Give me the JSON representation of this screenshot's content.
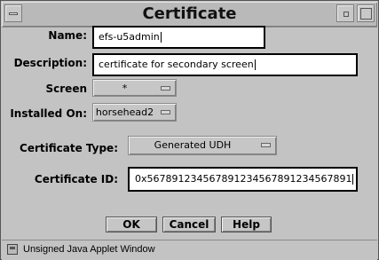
{
  "window": {
    "title": "Certificate"
  },
  "form": {
    "name": {
      "label": "Name:",
      "value": "efs-u5admin"
    },
    "description": {
      "label": "Description:",
      "value": "certificate for secondary screen"
    },
    "screen": {
      "label": "Screen",
      "value": "*"
    },
    "installed_on": {
      "label": "Installed On:",
      "value": "horsehead2"
    },
    "certificate_type": {
      "label": "Certificate Type:",
      "value": "Generated UDH"
    },
    "certificate_id": {
      "label": "Certificate ID:",
      "value": "0x567891234567891234567891234567891"
    }
  },
  "buttons": {
    "ok": "OK",
    "cancel": "Cancel",
    "help": "Help"
  },
  "status_bar": {
    "text": "Unsigned Java Applet Window"
  },
  "icons": {
    "window_menu": "window-menu-icon",
    "minimize": "minimize-icon",
    "maximize": "maximize-icon",
    "dropdown": "dropdown-indicator-icon",
    "applet": "applet-warning-icon"
  }
}
